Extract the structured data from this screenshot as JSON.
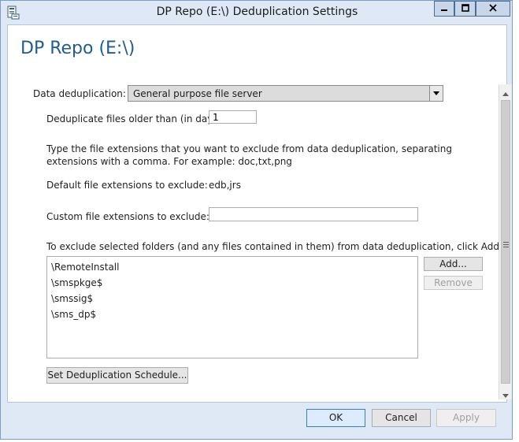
{
  "window": {
    "title": "DP Repo (E:\\) Deduplication Settings"
  },
  "page": {
    "heading": "DP Repo (E:\\)"
  },
  "dedup": {
    "label": "Data deduplication:",
    "selected": "General purpose file server"
  },
  "older_than": {
    "label": "Deduplicate files older than (in days):",
    "value": "1"
  },
  "instructions": {
    "line1": "Type the file extensions that you want to exclude from data deduplication, separating",
    "line2": "extensions with a comma. For example: doc,txt,png"
  },
  "default_ext": {
    "label": "Default file extensions to exclude:",
    "value": "edb,jrs"
  },
  "custom_ext": {
    "label": "Custom file extensions to exclude:",
    "value": ""
  },
  "folders": {
    "instruction": "To exclude selected folders (and any files contained in them) from data deduplication, click Add.",
    "items": [
      "\\RemoteInstall",
      "\\smspkge$",
      "\\smssig$",
      "\\sms_dp$"
    ],
    "add_label": "Add...",
    "remove_label": "Remove"
  },
  "schedule_button": "Set Deduplication Schedule...",
  "footer": {
    "ok": "OK",
    "cancel": "Cancel",
    "apply": "Apply"
  },
  "icons": {
    "app": "server-manager-icon",
    "minimize": "minimize-icon",
    "maximize": "maximize-icon",
    "close": "close-icon"
  },
  "colors": {
    "heading": "#1e5d8d",
    "frame": "#dfe8f5",
    "frame_border": "#7a9cc6"
  }
}
